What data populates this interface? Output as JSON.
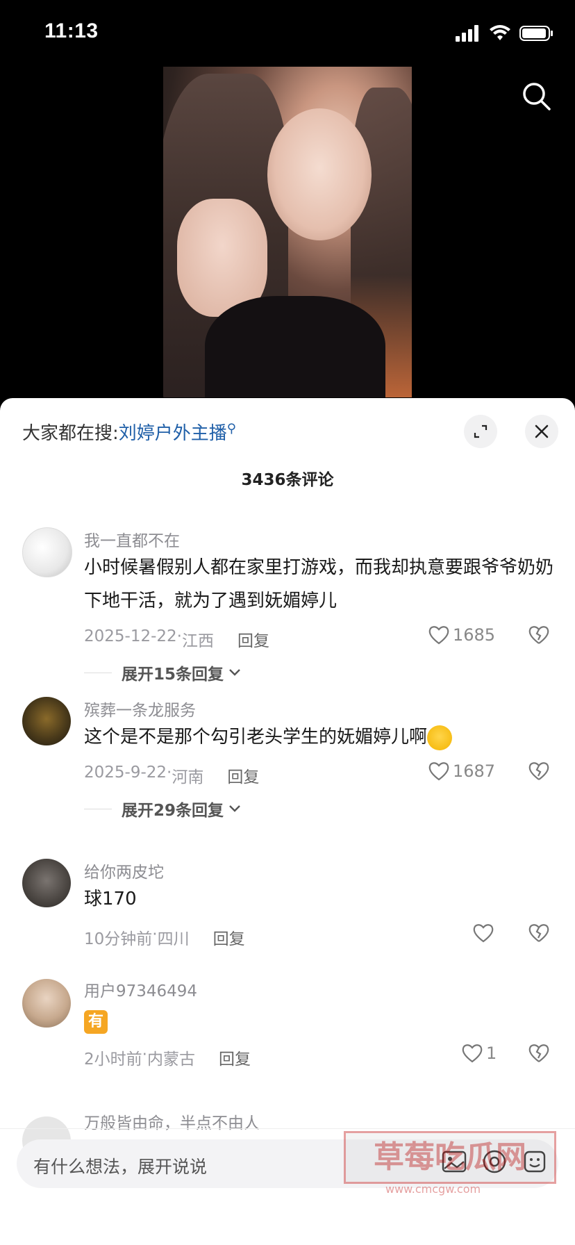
{
  "status": {
    "time": "11:13"
  },
  "hot_search": {
    "prefix": "大家都在搜:",
    "term": "刘婷户外主播"
  },
  "comment_count": "3436条评论",
  "comments": [
    {
      "username": "我一直都不在",
      "text": "小时候暑假别人都在家里打游戏，而我却执意要跟爷爷奶奶下地干活，就为了遇到妩媚婷儿",
      "date": "2025-12-22",
      "location": "江西",
      "reply_label": "回复",
      "likes": "1685",
      "expand_label": "展开15条回复"
    },
    {
      "username": "殡葬一条龙服务",
      "text": "这个是不是那个勾引老头学生的妩媚婷儿啊",
      "date": "2025-9-22",
      "location": "河南",
      "reply_label": "回复",
      "likes": "1687",
      "expand_label": "展开29条回复"
    },
    {
      "username": "给你两皮坨",
      "text": "球170",
      "date": "10分钟前",
      "location": "四川",
      "reply_label": "回复",
      "likes": ""
    },
    {
      "username": "用户97346494",
      "text": "有",
      "date": "2小时前",
      "location": "内蒙古",
      "reply_label": "回复",
      "likes": "1"
    },
    {
      "username": "万般皆由命，半点不由人"
    }
  ],
  "input": {
    "placeholder": "有什么想法，展开说说"
  },
  "watermark": {
    "text": "草莓吃瓜网",
    "url": "www.cmcgw.com"
  },
  "icons": {
    "search": "search-icon",
    "expand": "expand-icon",
    "close": "close-icon",
    "like": "heart-icon",
    "dislike": "broken-heart-icon"
  }
}
